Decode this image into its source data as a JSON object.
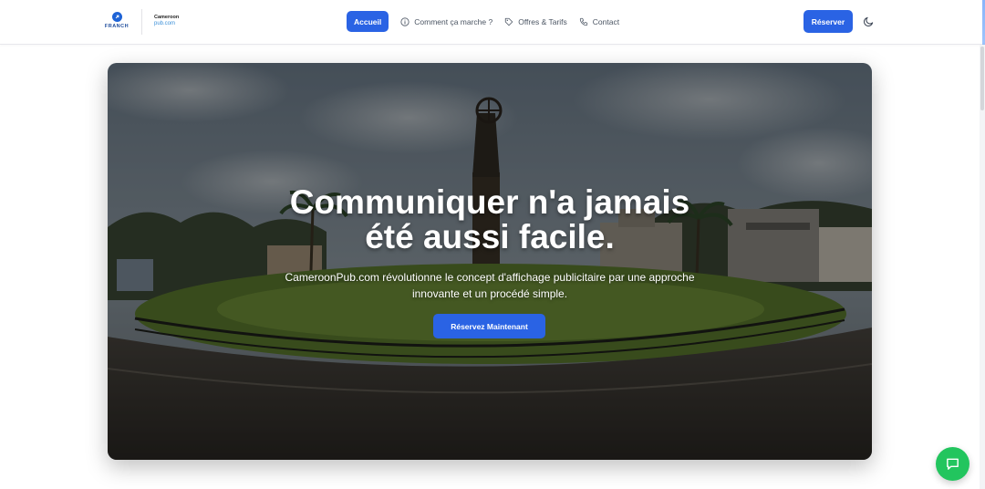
{
  "header": {
    "logo_primary_text": "FRANCH",
    "logo_secondary_line1": "Cameroon",
    "logo_secondary_line2": "pub.com",
    "nav": {
      "home": "Accueil",
      "how_it_works": "Comment ça marche ?",
      "offers": "Offres & Tarifs",
      "contact": "Contact"
    },
    "reserve_label": "Réserver",
    "theme_icon": "moon-icon"
  },
  "hero": {
    "title_line1": "Communiquer n'a jamais",
    "title_line2": "été aussi facile.",
    "subtitle_line1": "CameroonPub.com révolutionne le concept d'affichage publicitaire par une approche",
    "subtitle_line2": "innovante et un procédé simple.",
    "cta_label": "Réservez Maintenant"
  },
  "chat": {
    "icon": "chat-icon"
  },
  "colors": {
    "accent": "#2a63e4",
    "chat": "#22c55e"
  }
}
